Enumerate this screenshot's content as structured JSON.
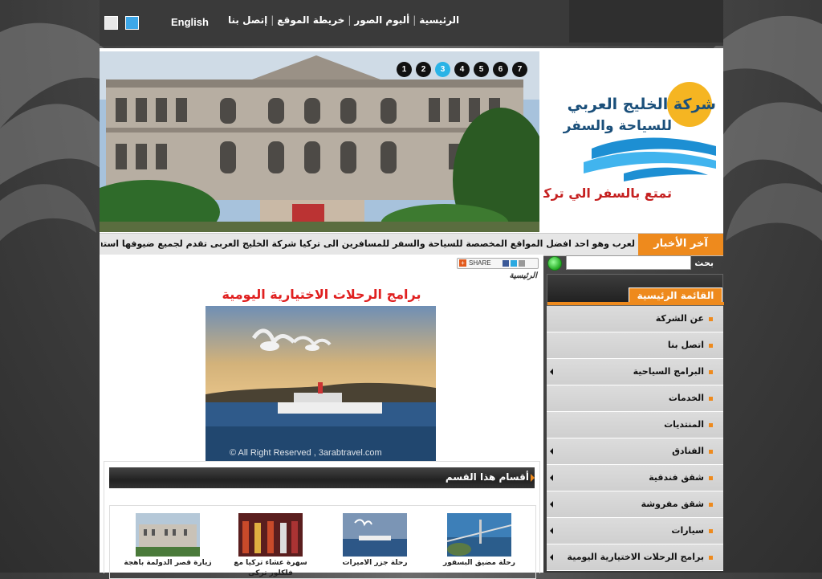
{
  "top_nav": {
    "items": [
      "الرئيسية",
      "ألبوم الصور",
      "خريطة الموقع",
      "إتصل بنا"
    ],
    "english_label": "English"
  },
  "slider": {
    "pages": [
      "1",
      "2",
      "3",
      "4",
      "5",
      "6",
      "7"
    ],
    "active_page": "3"
  },
  "logo": {
    "company_name": "شركة الخليج العربي",
    "subtitle": "للسياحة والسفر",
    "tagline": "تمتع بالسفر الي تركيا"
  },
  "news": {
    "label": "آخر الأخبار",
    "ticker": "لعرب وهو احد افضل المواقع المخصصة للسياحة والسفر للمسافرين الى تركيا شركة الخليج العربى تقدم لجميع ضيوفها استفساراتهم والبرامج السياحية الى تر"
  },
  "share": {
    "label": "SHARE"
  },
  "breadcrumb": "الرئيسية",
  "page_title": "برامج الرحلات الاختيارية اليومية",
  "photo_watermark": "© All Right Reserved , 3arabtravel.com",
  "section": {
    "title": "أقسام هذا القسم",
    "items": [
      {
        "caption": "رحلة مضيق البسفور"
      },
      {
        "caption": "رحلة جزر الاميرات"
      },
      {
        "caption": "سهرة عشاء تركيا مع فلكلور تركى"
      },
      {
        "caption": "زيارة قصر الدولمة باهجة"
      }
    ]
  },
  "search": {
    "label": "بحث",
    "value": ""
  },
  "sidebar_menu": {
    "title": "القائمة الرئيسية",
    "items": [
      {
        "label": "عن الشركة",
        "submenu": false
      },
      {
        "label": "اتصل بنا",
        "submenu": false
      },
      {
        "label": "البرامج السياحية",
        "submenu": true
      },
      {
        "label": "الخدمات",
        "submenu": false
      },
      {
        "label": "المنتديات",
        "submenu": false
      },
      {
        "label": "الفنادق",
        "submenu": true
      },
      {
        "label": "شقق فندقية",
        "submenu": true
      },
      {
        "label": "شقق مفروشة",
        "submenu": true
      },
      {
        "label": "سيارات",
        "submenu": true
      },
      {
        "label": "برامج الرحلات الاختيارية اليومية",
        "submenu": true
      }
    ]
  },
  "colors": {
    "accent": "#ee8a1d",
    "title_red": "#e02020",
    "slider_active": "#2ab3e6"
  }
}
